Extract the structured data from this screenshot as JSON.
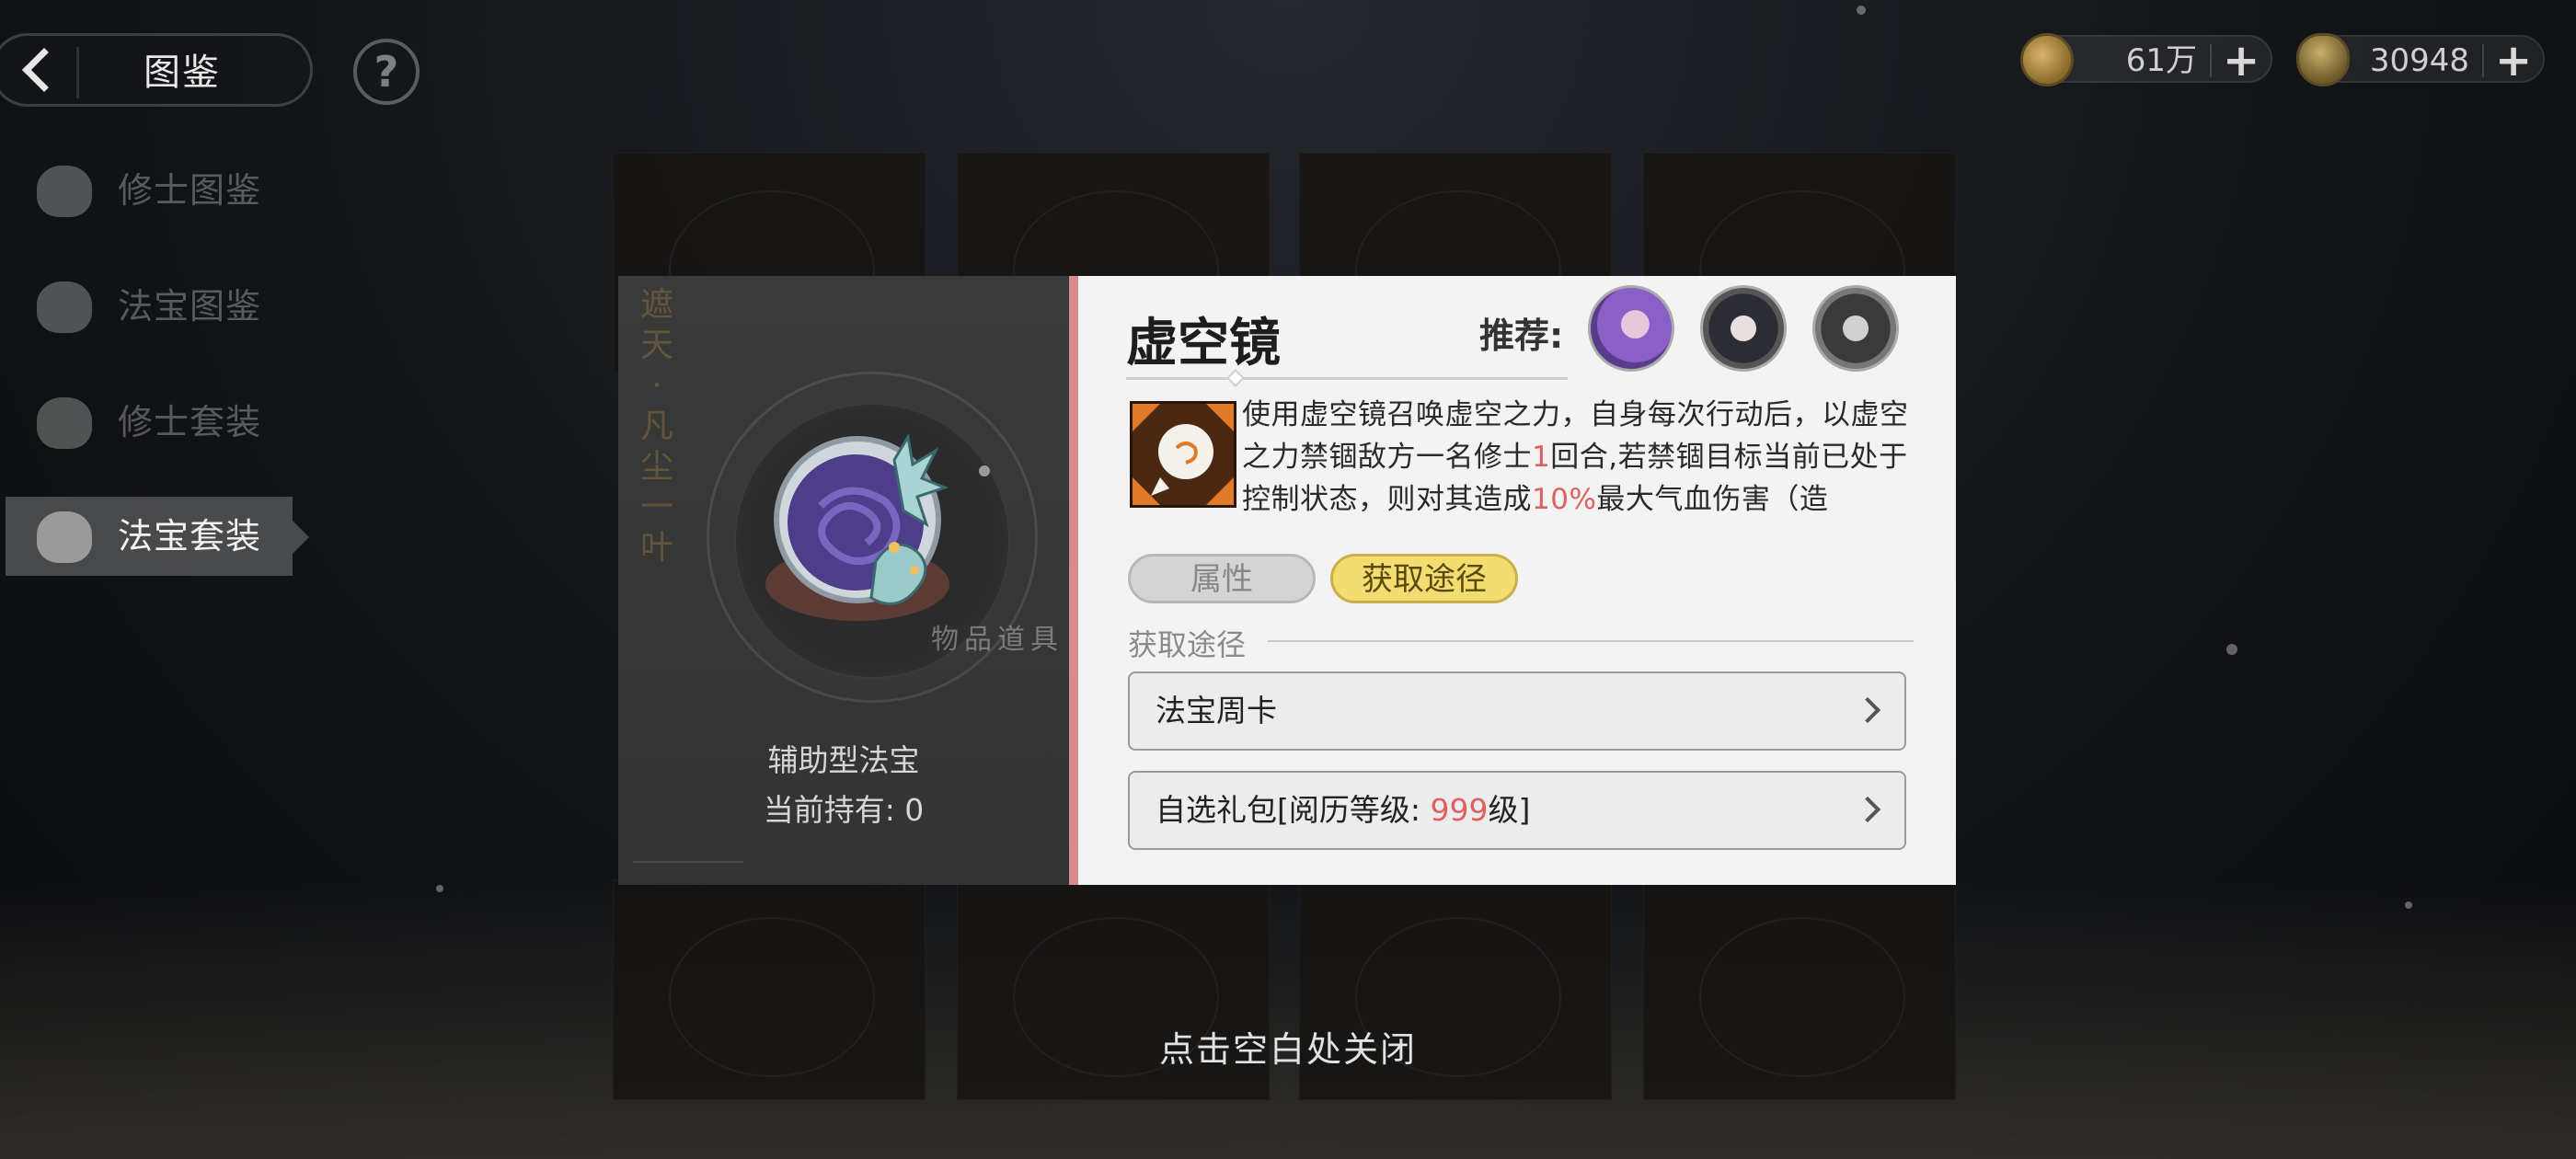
{
  "header": {
    "back_icon": "chevron-left-icon",
    "title": "图鉴",
    "help_icon": "question-icon",
    "help_glyph": "?"
  },
  "currencies": [
    {
      "icon": "spirit-stone-coin-icon",
      "value": "61万",
      "plus": "+"
    },
    {
      "icon": "gourd-icon",
      "value": "30948",
      "plus": "+"
    }
  ],
  "sidebar": {
    "items": [
      {
        "label": "修士图鉴",
        "active": false
      },
      {
        "label": "法宝图鉴",
        "active": false
      },
      {
        "label": "修士套装",
        "active": false
      },
      {
        "label": "法宝套装",
        "active": true
      }
    ]
  },
  "item_panel": {
    "vertical_text": "遮天·凡尘一叶",
    "tag": "物品道具",
    "type": "辅助型法宝",
    "owned_label": "当前持有: 0"
  },
  "detail": {
    "title": "虚空镜",
    "recommend_label": "推荐:",
    "skill_text": {
      "part1": "使用虚空镜召唤虚空之力，自身每次行动后，以虚空之力禁锢敌方一名修士",
      "hl1": "1",
      "part2": "回合,若禁锢目标当前已处于控制状态，则对其造成",
      "hl2": "10%",
      "part3": "最大气血伤害（造"
    },
    "tabs": [
      {
        "label": "属性",
        "active": false
      },
      {
        "label": "获取途径",
        "active": true
      }
    ],
    "section_title": "获取途径",
    "sources": [
      {
        "label": "法宝周卡"
      },
      {
        "label_prefix": "自选礼包[阅历等级: ",
        "label_highlight": "999",
        "label_suffix": "级]"
      }
    ]
  },
  "close_hint": "点击空白处关闭",
  "colors": {
    "accent_red": "#e06060",
    "tab_active": "#f3dc70",
    "accent_bar": "#d88c8c"
  }
}
